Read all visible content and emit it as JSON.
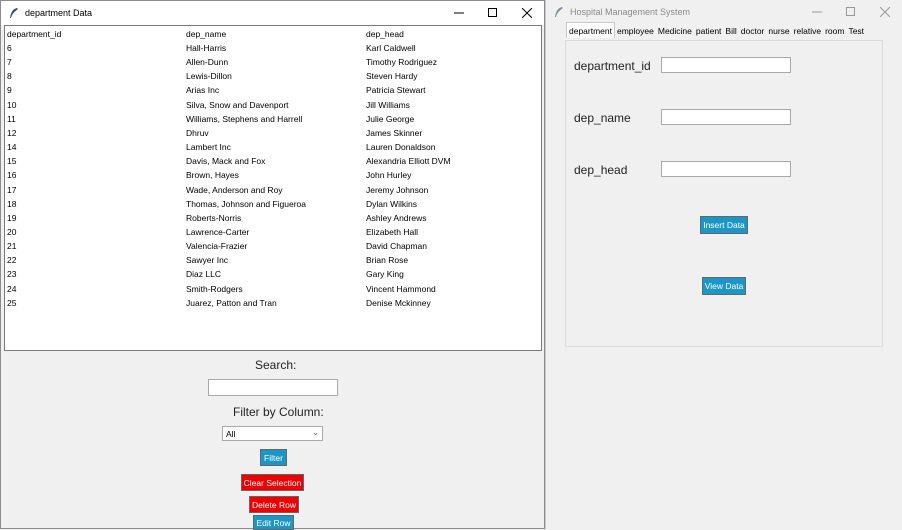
{
  "left_window": {
    "title": "department Data",
    "columns": [
      "department_id",
      "dep_name",
      "dep_head"
    ],
    "rows": [
      [
        "6",
        "Hall-Harris",
        "Karl Caldwell"
      ],
      [
        "7",
        "Allen-Dunn",
        "Timothy Rodriguez"
      ],
      [
        "8",
        "Lewis-Dillon",
        "Steven Hardy"
      ],
      [
        "9",
        "Arias Inc",
        "Patricia Stewart"
      ],
      [
        "10",
        "Silva, Snow and Davenport",
        "Jill Williams"
      ],
      [
        "11",
        "Williams, Stephens and Harrell",
        "Julie George"
      ],
      [
        "12",
        "Dhruv",
        "James Skinner"
      ],
      [
        "14",
        "Lambert Inc",
        "Lauren Donaldson"
      ],
      [
        "15",
        "Davis, Mack and Fox",
        "Alexandria Elliott DVM"
      ],
      [
        "16",
        "Brown, Hayes",
        "John Hurley"
      ],
      [
        "17",
        "Wade, Anderson and Roy",
        "Jeremy Johnson"
      ],
      [
        "18",
        "Thomas, Johnson and Figueroa",
        "Dylan Wilkins"
      ],
      [
        "19",
        "Roberts-Norris",
        "Ashley Andrews"
      ],
      [
        "20",
        "Lawrence-Carter",
        "Elizabeth Hall"
      ],
      [
        "21",
        "Valencia-Frazier",
        "David Chapman"
      ],
      [
        "22",
        "Sawyer Inc",
        "Brian Rose"
      ],
      [
        "23",
        "Diaz LLC",
        "Gary King"
      ],
      [
        "24",
        "Smith-Rodgers",
        "Vincent Hammond"
      ],
      [
        "25",
        "Juarez, Patton and Tran",
        "Denise Mckinney"
      ]
    ],
    "search_label": "Search:",
    "search_value": "",
    "filter_label": "Filter by Column:",
    "filter_selected": "All",
    "buttons": {
      "filter": "Filter",
      "clear": "Clear Selection",
      "delete": "Delete Row",
      "edit": "Edit Row"
    }
  },
  "right_window": {
    "title": "Hospital Management System",
    "tabs": [
      "department",
      "employee",
      "Medicine",
      "patient",
      "Bill",
      "doctor",
      "nurse",
      "relative",
      "room",
      "Test"
    ],
    "active_tab": "department",
    "fields": [
      {
        "label": "department_id",
        "value": ""
      },
      {
        "label": "dep_name",
        "value": ""
      },
      {
        "label": "dep_head",
        "value": ""
      }
    ],
    "buttons": {
      "insert": "Insert Data",
      "view": "View Data"
    }
  },
  "icons": {
    "app": "feather-icon",
    "minimize": "minimize-icon",
    "maximize": "maximize-icon",
    "close": "close-icon",
    "dropdown": "chevron-down-icon"
  },
  "colors": {
    "button_blue": "#1a97c7",
    "button_red": "#ee0000"
  }
}
